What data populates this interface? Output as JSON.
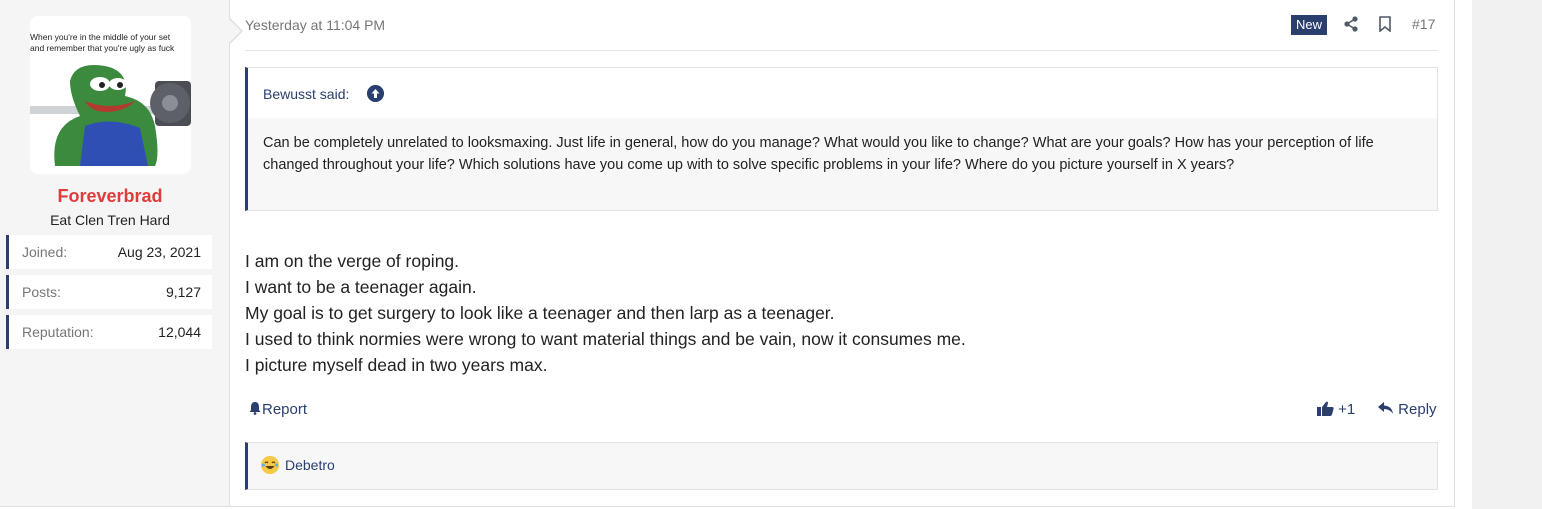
{
  "user": {
    "avatar_caption": [
      "When you're in the middle of your set",
      "and remember that you're ugly as fuck"
    ],
    "username": "Foreverbrad",
    "title": "Eat Clen Tren Hard",
    "stats": [
      {
        "label": "Joined:",
        "value": "Aug 23, 2021"
      },
      {
        "label": "Posts:",
        "value": "9,127"
      },
      {
        "label": "Reputation:",
        "value": "12,044"
      }
    ]
  },
  "meta": {
    "date": "Yesterday at 11:04 PM",
    "badge": "New",
    "post_number": "#17"
  },
  "quote": {
    "author": "Bewusst said:",
    "text": "Can be completely unrelated to looksmaxing. Just life in general, how do you manage? What would you like to change? What are your goals? How has your perception of life changed throughout your life? Which solutions have you come up with to solve specific problems in your life? Where do you picture yourself in X years?"
  },
  "message": {
    "lines": [
      "I am on the verge of roping.",
      "I want to be a teenager again.",
      "My goal is to get surgery to look like a teenager and then larp as a teenager.",
      "I used to think normies were wrong to want material things and be vain, now it consumes me.",
      "I picture myself dead in two years max."
    ]
  },
  "actions": {
    "report": "Report",
    "like": "+1",
    "reply": "Reply"
  },
  "reactions": {
    "user": "Debetro"
  },
  "colors": {
    "accent": "#2a3f6e",
    "username": "#e03c3c"
  }
}
